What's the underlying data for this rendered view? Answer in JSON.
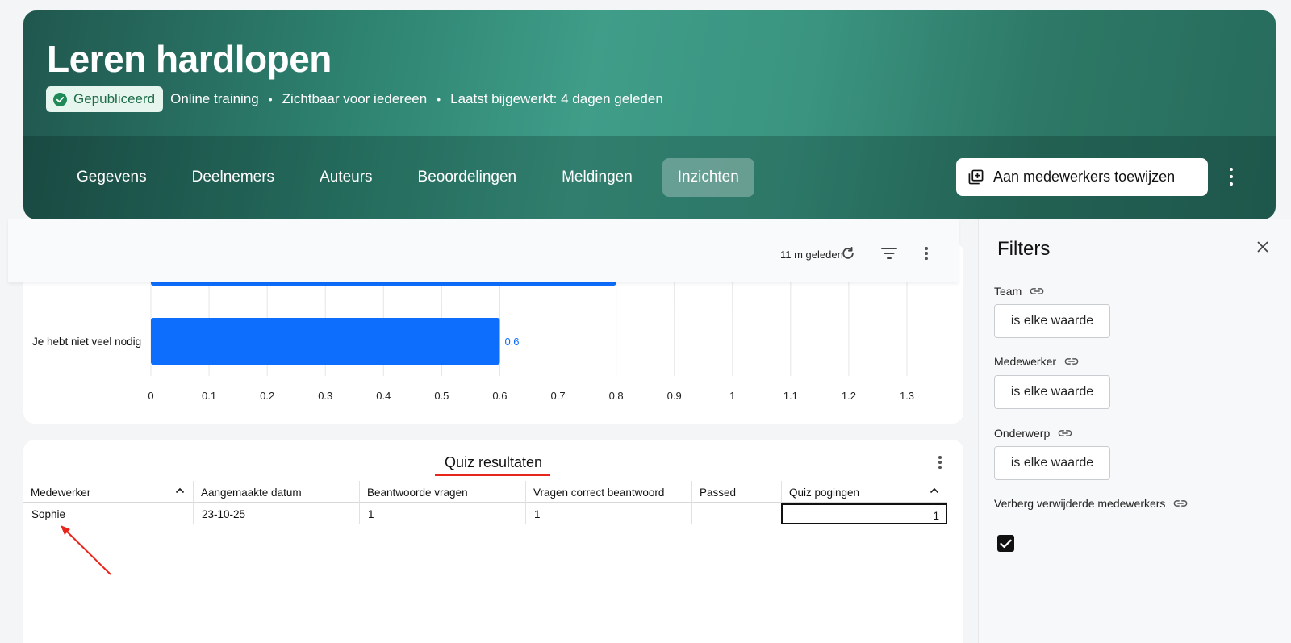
{
  "header": {
    "title": "Leren hardlopen",
    "status": "Gepubliceerd",
    "meta": [
      "Online training",
      "Zichtbaar voor iedereen",
      "Laatst bijgewerkt: 4 dagen geleden"
    ],
    "tabs": [
      "Gegevens",
      "Deelnemers",
      "Auteurs",
      "Beoordelingen",
      "Meldingen",
      "Inzichten"
    ],
    "active_tab": "Inzichten",
    "assign_button": "Aan medewerkers toewijzen"
  },
  "toolbar": {
    "refresh_time": "11 m geleden"
  },
  "chart_data": {
    "type": "bar",
    "orientation": "horizontal",
    "categories": [
      "",
      "Je hebt niet veel nodig"
    ],
    "values": [
      0.8,
      0.6
    ],
    "data_labels": [
      "",
      "0.6"
    ],
    "x_ticks": [
      "0",
      "0.1",
      "0.2",
      "0.3",
      "0.4",
      "0.5",
      "0.6",
      "0.7",
      "0.8",
      "0.9",
      "1",
      "1.1",
      "1.2",
      "1.3"
    ],
    "xlim": [
      0,
      1.3
    ],
    "grid": true,
    "bar_color": "#0d6efd"
  },
  "quiz": {
    "title": "Quiz resultaten",
    "columns": [
      "Medewerker",
      "Aangemaakte datum",
      "Beantwoorde vragen",
      "Vragen correct beantwoord",
      "Passed",
      "Quiz pogingen"
    ],
    "rows": [
      [
        "Sophie",
        "23-10-25",
        "1",
        "1",
        "",
        "1"
      ]
    ]
  },
  "filters": {
    "title": "Filters",
    "items": [
      {
        "label": "Team",
        "value": "is elke waarde"
      },
      {
        "label": "Medewerker",
        "value": "is elke waarde"
      },
      {
        "label": "Onderwerp",
        "value": "is elke waarde"
      }
    ],
    "hide_deleted_label": "Verberg verwijderde medewerkers",
    "hide_deleted_checked": true
  },
  "colors": {
    "accent": "#3f9d88",
    "annotation": "#e8251b"
  }
}
